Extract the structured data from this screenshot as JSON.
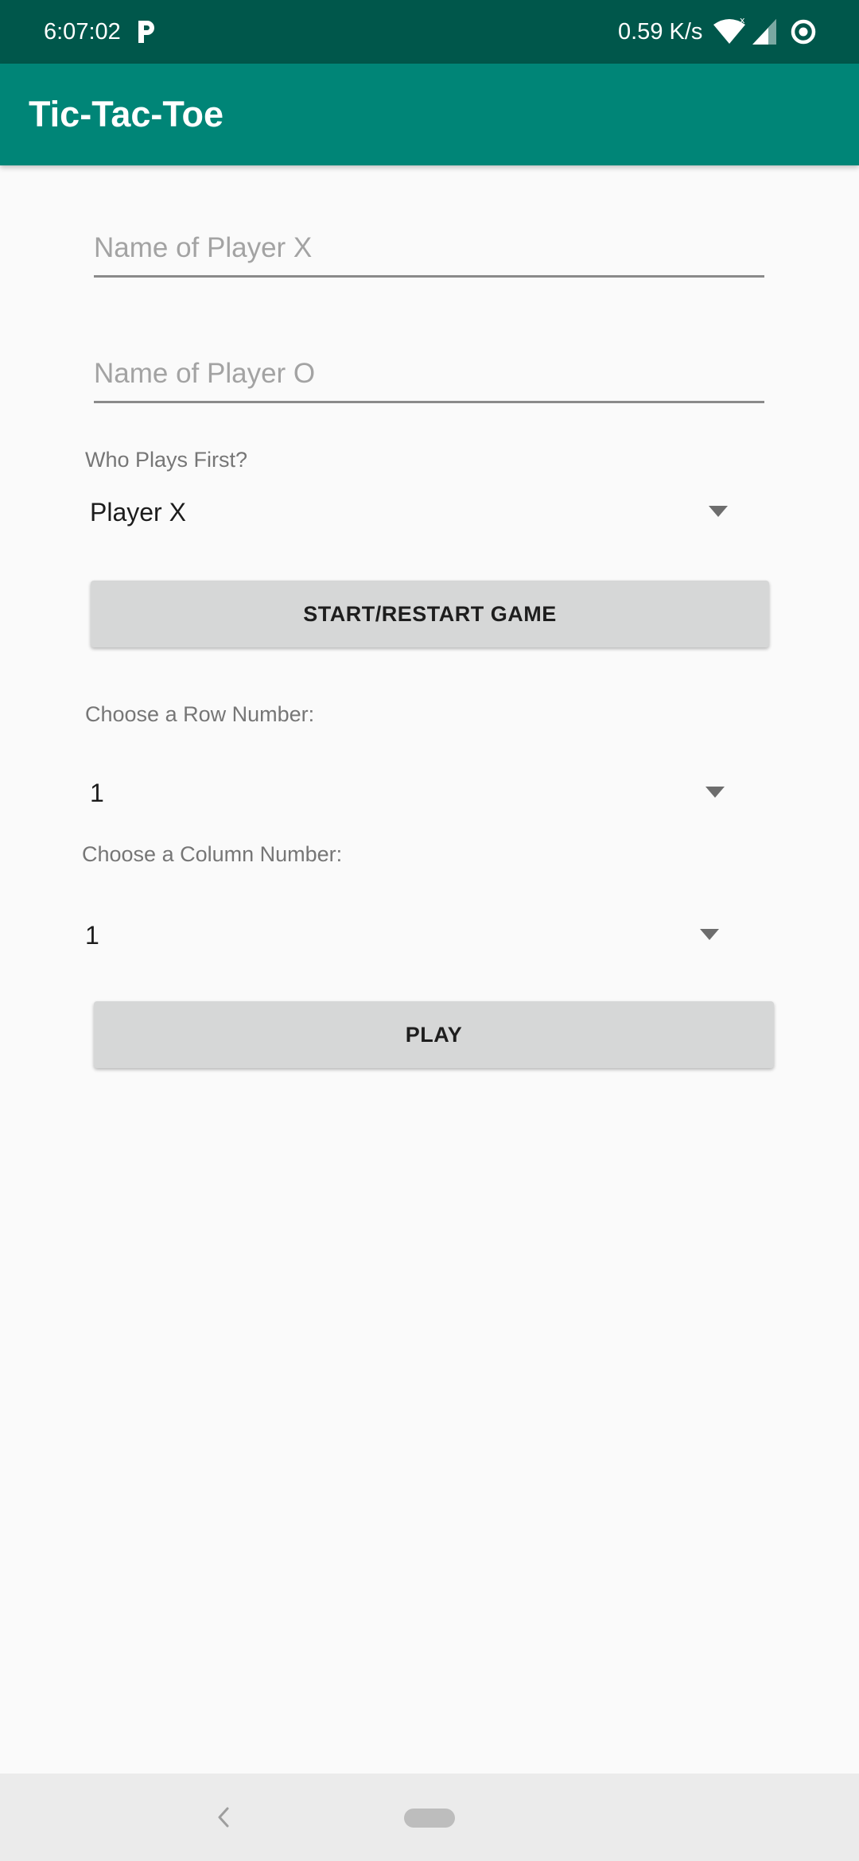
{
  "status_bar": {
    "time": "6:07:02",
    "network_speed": "0.59 K/s",
    "icons": [
      "p-app-icon",
      "wifi-icon",
      "signal-icon",
      "sync-icon"
    ]
  },
  "app_bar": {
    "title": "Tic-Tac-Toe"
  },
  "form": {
    "player_x_placeholder": "Name of Player X",
    "player_x_value": "",
    "player_o_placeholder": "Name of Player O",
    "player_o_value": "",
    "first_player_label": "Who Plays First?",
    "first_player_selected": "Player X",
    "start_button_label": "START/RESTART GAME",
    "row_label": "Choose a Row Number:",
    "row_selected": "1",
    "column_label": "Choose a Column Number:",
    "column_selected": "1",
    "play_button_label": "PLAY"
  },
  "colors": {
    "status_bar": "#00574b",
    "app_bar": "#008577",
    "background": "#fafafa",
    "button": "#d6d7d7"
  }
}
